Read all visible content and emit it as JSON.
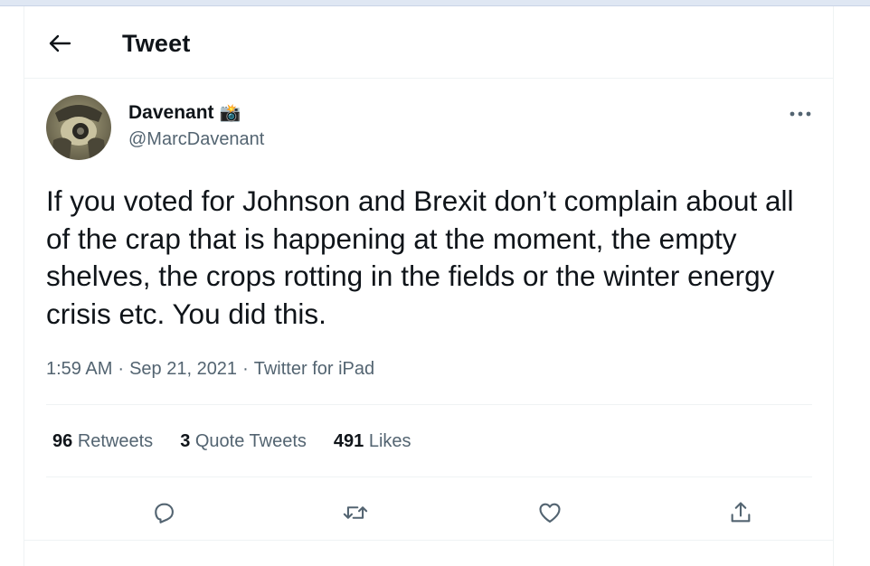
{
  "header": {
    "title": "Tweet",
    "back_icon": "arrow-left-icon"
  },
  "author": {
    "name": "Davenant",
    "name_emoji": "📸",
    "handle": "@MarcDavenant"
  },
  "tweet": {
    "text": "If you voted for Johnson and Brexit don’t complain about all of the crap that is happening at the moment, the empty shelves, the crops rotting in the fields or the winter energy crisis etc. You did this.",
    "time": "1:59 AM",
    "separator": "·",
    "date": "Sep 21, 2021",
    "source": "Twitter for iPad"
  },
  "stats": [
    {
      "count": "96",
      "label": "Retweets"
    },
    {
      "count": "3",
      "label": "Quote Tweets"
    },
    {
      "count": "491",
      "label": "Likes"
    }
  ],
  "actions": [
    "reply-icon",
    "retweet-icon",
    "like-icon",
    "share-icon"
  ],
  "colors": {
    "text": "#0f1419",
    "secondary": "#536471",
    "divider": "#eff3f4"
  }
}
